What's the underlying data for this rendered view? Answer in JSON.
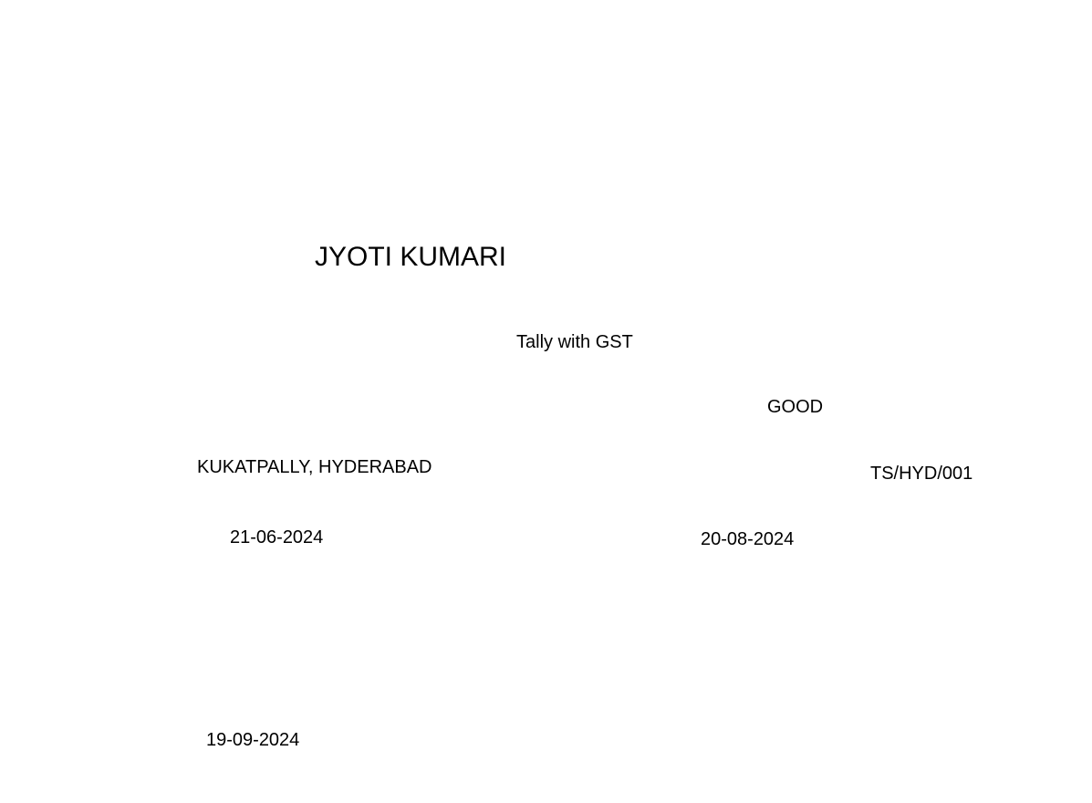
{
  "certificate": {
    "student_name": "JYOTI KUMARI",
    "course": "Tally with GST",
    "grade": "GOOD",
    "center_location": "KUKATPALLY, HYDERABAD",
    "center_code": "TS/HYD/001",
    "start_date": "21-06-2024",
    "end_date": "20-08-2024",
    "issue_date": "19-09-2024"
  }
}
